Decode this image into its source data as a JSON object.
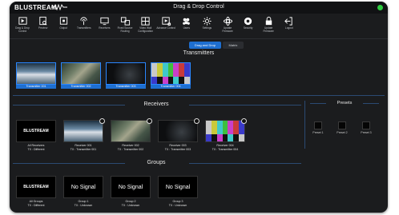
{
  "app": {
    "brand": "BLUSTREAM",
    "page_title": "Drag & Drop Control"
  },
  "toolbar": [
    {
      "name": "drag-drop",
      "label": "Drag & Drop Control",
      "icon": "drag-drop-icon",
      "active": true
    },
    {
      "name": "preview",
      "label": "Preview",
      "icon": "preview-icon"
    },
    {
      "name": "output",
      "label": "Output",
      "icon": "output-icon"
    },
    {
      "name": "transmitters",
      "label": "Transmitters",
      "icon": "transmitter-icon"
    },
    {
      "name": "receivers",
      "label": "Receivers",
      "icon": "receiver-icon"
    },
    {
      "name": "fixed-source-routing",
      "label": "Fixed Source Routing",
      "icon": "routing-icon"
    },
    {
      "name": "video-wall",
      "label": "Video Wall Configuration",
      "icon": "video-wall-icon"
    },
    {
      "name": "advanced-control",
      "label": "Advance Control",
      "icon": "advanced-icon"
    },
    {
      "name": "users",
      "label": "Users",
      "icon": "users-icon"
    },
    {
      "name": "settings",
      "label": "Settings",
      "icon": "settings-icon"
    },
    {
      "name": "update-firmware",
      "label": "Update Firmware",
      "icon": "update-icon"
    },
    {
      "name": "security",
      "label": "Security",
      "icon": "security-icon"
    },
    {
      "name": "update-firmware-2",
      "label": "Update Firmware",
      "icon": "lock-icon"
    },
    {
      "name": "logout",
      "label": "Logout",
      "icon": "logout-icon"
    }
  ],
  "mode_toggle": {
    "active": "Drag and Drop",
    "inactive": "Matrix"
  },
  "transmitters": {
    "title": "Transmitters",
    "items": [
      {
        "name": "Transmitter 001",
        "thumb": "film"
      },
      {
        "name": "Transmitter 002",
        "thumb": "forest"
      },
      {
        "name": "Transmitter 003",
        "thumb": "dark"
      },
      {
        "name": "Transmitter 004",
        "thumb": "bars"
      }
    ]
  },
  "receivers": {
    "title": "Receivers",
    "items": [
      {
        "name": "All Receivers",
        "tx": "TX : Different",
        "thumb": "logo",
        "clear": false
      },
      {
        "name": "Receiver 001",
        "tx": "TX : Transmitter 001",
        "thumb": "film",
        "clear": true
      },
      {
        "name": "Receiver 002",
        "tx": "TX : Transmitter 002",
        "thumb": "forest",
        "clear": true
      },
      {
        "name": "Receiver 003",
        "tx": "TX : Transmitter 003",
        "thumb": "dark",
        "clear": true
      },
      {
        "name": "Receiver 004",
        "tx": "TX : Transmitter 004",
        "thumb": "bars",
        "clear": true
      }
    ]
  },
  "presets": {
    "title": "Presets",
    "items": [
      {
        "label": "Preset 1"
      },
      {
        "label": "Preset 2"
      },
      {
        "label": "Preset 3"
      }
    ]
  },
  "groups": {
    "title": "Groups",
    "items": [
      {
        "name": "All Groups",
        "tx": "TX : Different",
        "thumb": "logo",
        "signal": ""
      },
      {
        "name": "Group 1",
        "tx": "TX : Unknown",
        "thumb": "nosignal",
        "signal": "No Signal"
      },
      {
        "name": "Group 2",
        "tx": "TX : Unknown",
        "thumb": "nosignal",
        "signal": "No Signal"
      },
      {
        "name": "Group 3",
        "tx": "TX : Unknown",
        "thumb": "nosignal",
        "signal": "No Signal"
      }
    ]
  },
  "colors": {
    "accent": "#1e6fd1",
    "status": "#2ecc40",
    "background": "#1b1c1e"
  },
  "bar_colors": [
    "#c9c9c9",
    "#c9c93a",
    "#3fc9c9",
    "#3fbf3f",
    "#c93fc9",
    "#c93a3a",
    "#3a3ac9"
  ]
}
